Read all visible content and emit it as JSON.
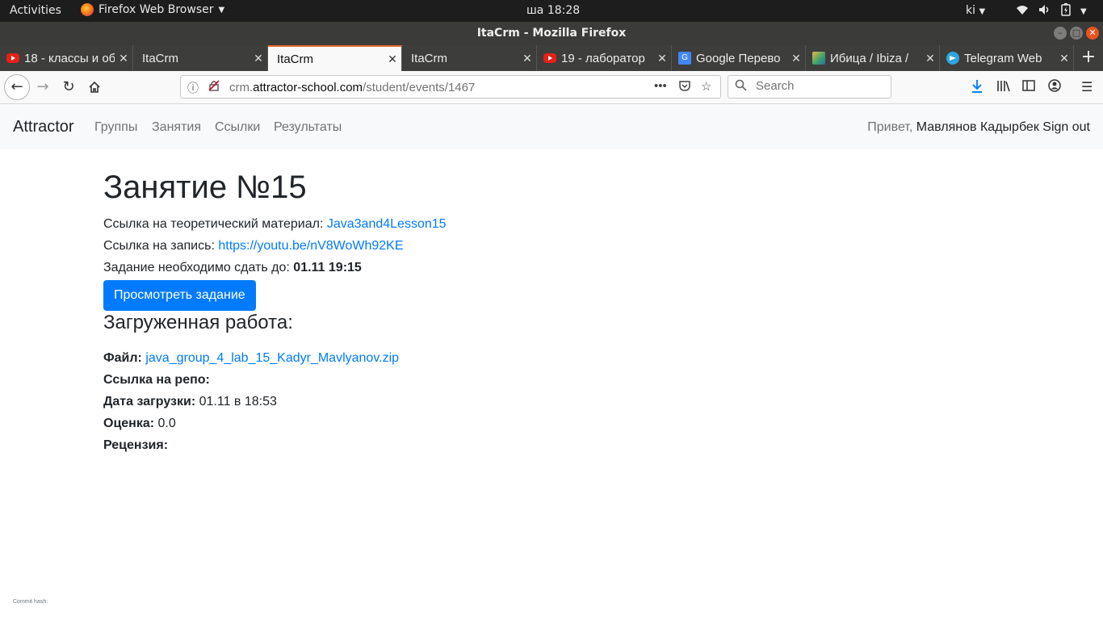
{
  "system": {
    "activities": "Activities",
    "app_menu": "Firefox Web Browser",
    "clock": "ша 18:28",
    "user": "ki"
  },
  "window": {
    "title": "ItaCrm - Mozilla Firefox"
  },
  "tabs": [
    {
      "label": "18 - классы и об",
      "icon": "youtube-icon"
    },
    {
      "label": "ItaCrm",
      "icon": ""
    },
    {
      "label": "ItaCrm",
      "icon": "",
      "active": true
    },
    {
      "label": "ItaCrm",
      "icon": ""
    },
    {
      "label": "19 - лаборатор",
      "icon": "youtube-icon"
    },
    {
      "label": "Google Перево",
      "icon": "google-translate-icon"
    },
    {
      "label": "Ибица / Ibiza /",
      "icon": "ibiza-icon"
    },
    {
      "label": "Telegram Web",
      "icon": "telegram-icon"
    }
  ],
  "toolbar": {
    "url_prefix": "crm.",
    "url_domain": "attractor-school.com",
    "url_path": "/student/events/1467",
    "search_placeholder": "Search"
  },
  "site": {
    "brand": "Attractor",
    "nav": [
      "Группы",
      "Занятия",
      "Ссылки",
      "Результаты"
    ],
    "greeting": "Привет,",
    "user_name": "Мавлянов Кадырбек",
    "sign_out": "Sign out"
  },
  "lesson": {
    "title": "Занятие №15",
    "theory_label": "Ссылка на теоретический материал:",
    "theory_link": "Java3and4Lesson15",
    "record_label": "Ссылка на запись:",
    "record_link": "https://youtu.be/nV8WoWh92KE",
    "deadline_label": "Задание необходимо сдать до:",
    "deadline_value": "01.11 19:15",
    "view_task_button": "Просмотреть задание"
  },
  "submission": {
    "heading": "Загруженная работа:",
    "file_label": "Файл:",
    "file_link": "java_group_4_lab_15_Kadyr_Mavlyanov.zip",
    "repo_label": "Ссылка на репо:",
    "upload_date_label": "Дата загрузки:",
    "upload_date_value": "01.11 в 18:53",
    "grade_label": "Оценка:",
    "grade_value": "0.0",
    "review_label": "Рецензия:"
  },
  "footer": {
    "commit_hash": "Commit hash:"
  },
  "colors": {
    "accent": "#007bff",
    "tab_active_indicator": "#e66a2c",
    "topbar": "#1d1d1d"
  }
}
